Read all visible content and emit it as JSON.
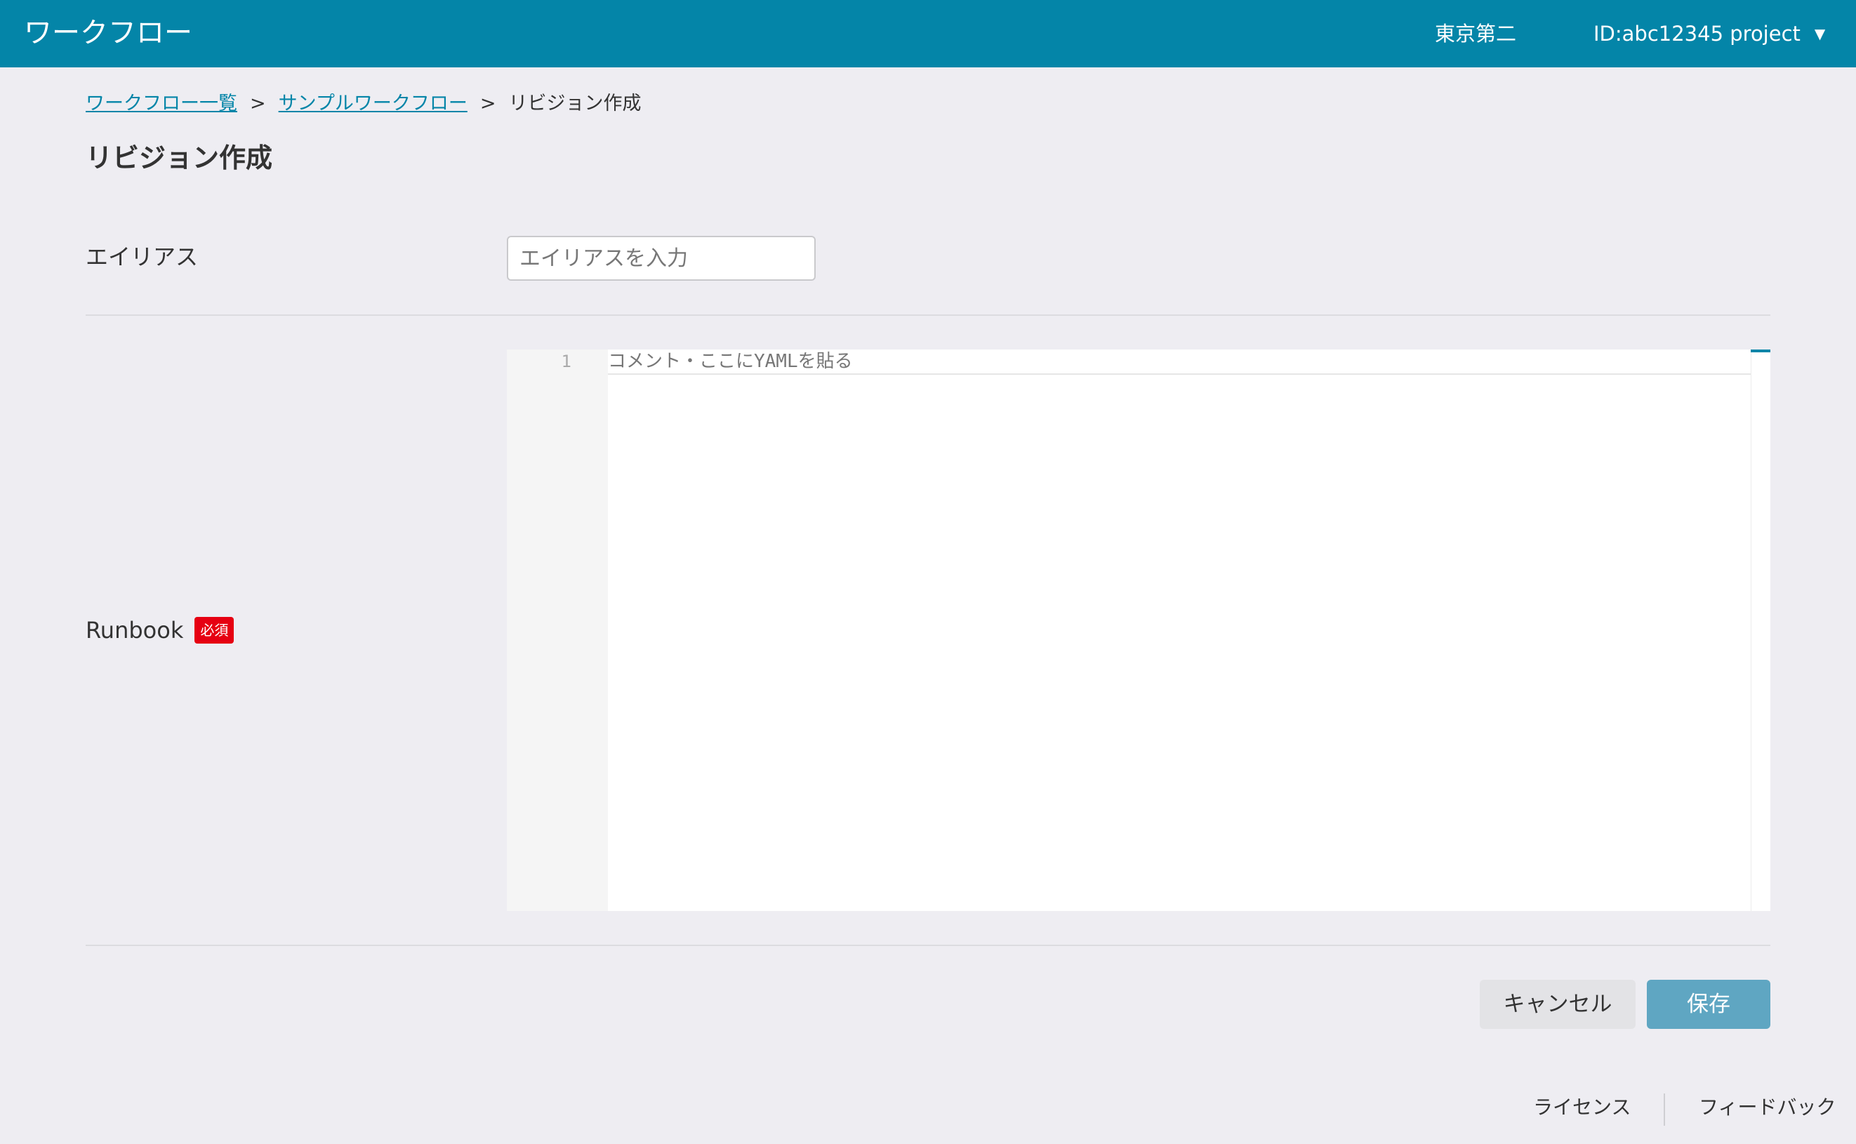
{
  "header": {
    "app_title": "ワークフロー",
    "region": "東京第二",
    "project": "ID:abc12345 project",
    "dropdown_icon": "caret-down-icon"
  },
  "breadcrumb": {
    "items": [
      "ワークフロー一覧",
      "サンプルワークフロー"
    ],
    "separator": ">",
    "current": "リビジョン作成"
  },
  "page": {
    "title": "リビジョン作成"
  },
  "form": {
    "alias_label": "エイリアス",
    "alias_value": "",
    "alias_placeholder": "エイリアスを入力",
    "runbook_label": "Runbook",
    "required_badge": "必須",
    "editor": {
      "line_number": "1",
      "placeholder": "コメント・ここにYAMLを貼る"
    }
  },
  "actions": {
    "cancel_label": "キャンセル",
    "save_label": "保存"
  },
  "footer": {
    "license_label": "ライセンス",
    "feedback_label": "フィードバック"
  },
  "colors": {
    "primary": "#0485a8",
    "save_button_disabled": "#5fa6c2",
    "required_badge": "#e60012",
    "background": "#eeedf2"
  }
}
